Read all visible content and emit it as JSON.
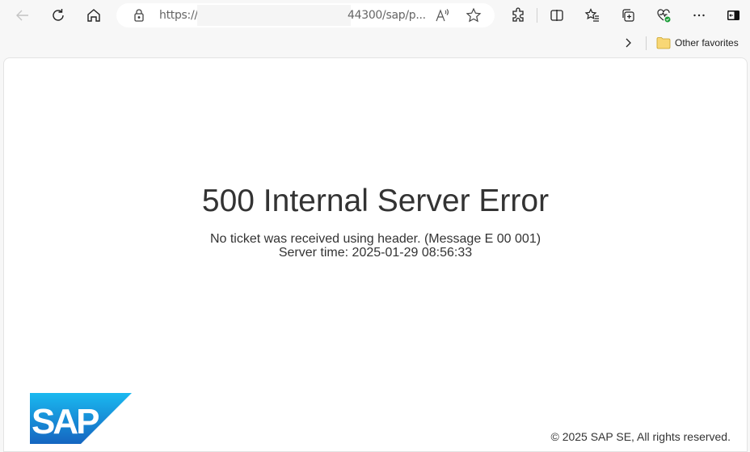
{
  "browser": {
    "address_bar": {
      "url_prefix": "https://",
      "url_suffix": "44300/sap/p...",
      "lock_icon": "lock-icon",
      "read_aloud_label": "A",
      "favorite_icon": "star-icon"
    },
    "toolbar_icons": [
      "back-icon",
      "refresh-icon",
      "home-icon",
      "extensions-icon",
      "split-screen-icon",
      "favorites-icon",
      "collections-icon",
      "browser-essentials-icon",
      "more-icon",
      "sidebar-icon"
    ],
    "favorites_bar": {
      "chevron_icon": "chevron-right-icon",
      "folder_label": "Other favorites"
    }
  },
  "page": {
    "title": "500 Internal Server Error",
    "message": "No ticket was received using header. (Message E 00 001)",
    "server_time": "Server time: 2025-01-29 08:56:33",
    "logo_text": "SAP",
    "copyright": "© 2025 SAP SE, All rights reserved.",
    "colors": {
      "logo_top": "#1ab9f0",
      "logo_bottom": "#1565c0",
      "text": "#333333"
    }
  }
}
